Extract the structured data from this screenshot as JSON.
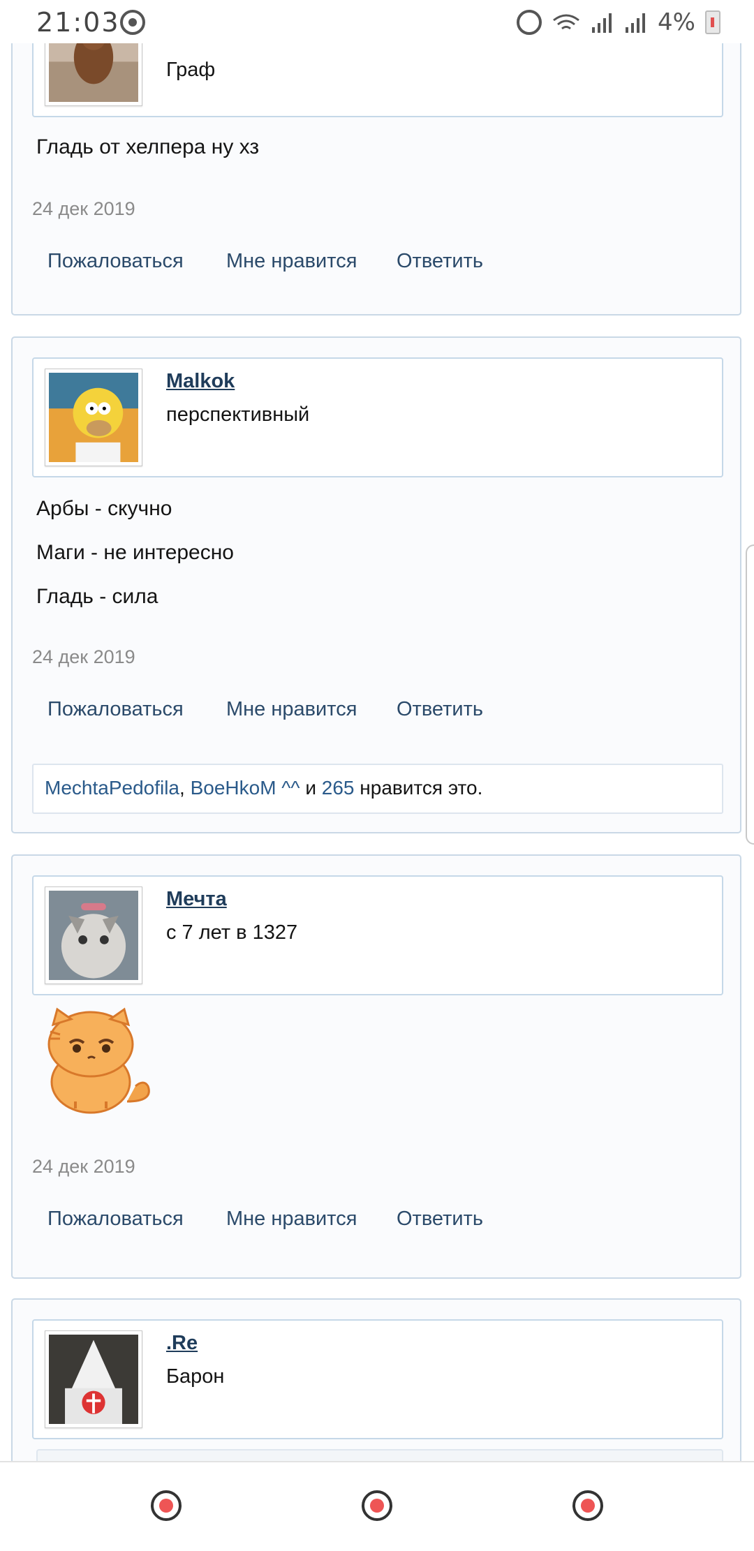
{
  "status_bar": {
    "time": "21:03",
    "battery": "4%"
  },
  "posts": [
    {
      "user_title": "Граф",
      "lines": [
        "Гладь от хелпера ну хз"
      ],
      "date": "24 дек 2019",
      "actions": [
        "Пожаловаться",
        "Мне нравится",
        "Ответить"
      ]
    },
    {
      "username": "Malkok",
      "user_title": "перспективный",
      "lines": [
        "Арбы - скучно",
        "Маги - не интересно",
        "Гладь - сила"
      ],
      "date": "24 дек 2019",
      "actions": [
        "Пожаловаться",
        "Мне нравится",
        "Ответить"
      ],
      "likes": {
        "user1": "MechtaPedofila",
        "sep": ",",
        "user2": "BoeHkoM ^^",
        "and": "и",
        "count": "265",
        "suffix": "нравится это."
      }
    },
    {
      "username": "Мечта",
      "user_title": "с 7 лет в 1327",
      "sticker": "sad-orange-cat-sticker",
      "date": "24 дек 2019",
      "actions": [
        "Пожаловаться",
        "Мне нравится",
        "Ответить"
      ]
    },
    {
      "username": ".Re",
      "user_title": "Барон"
    }
  ],
  "nav": {
    "icons": [
      "recent-apps-icon",
      "home-icon",
      "back-icon"
    ]
  },
  "colors": {
    "link": "#1f3c5a",
    "action": "#2b4a6a",
    "border": "#c9d8e6",
    "date": "#8a8a8a"
  }
}
